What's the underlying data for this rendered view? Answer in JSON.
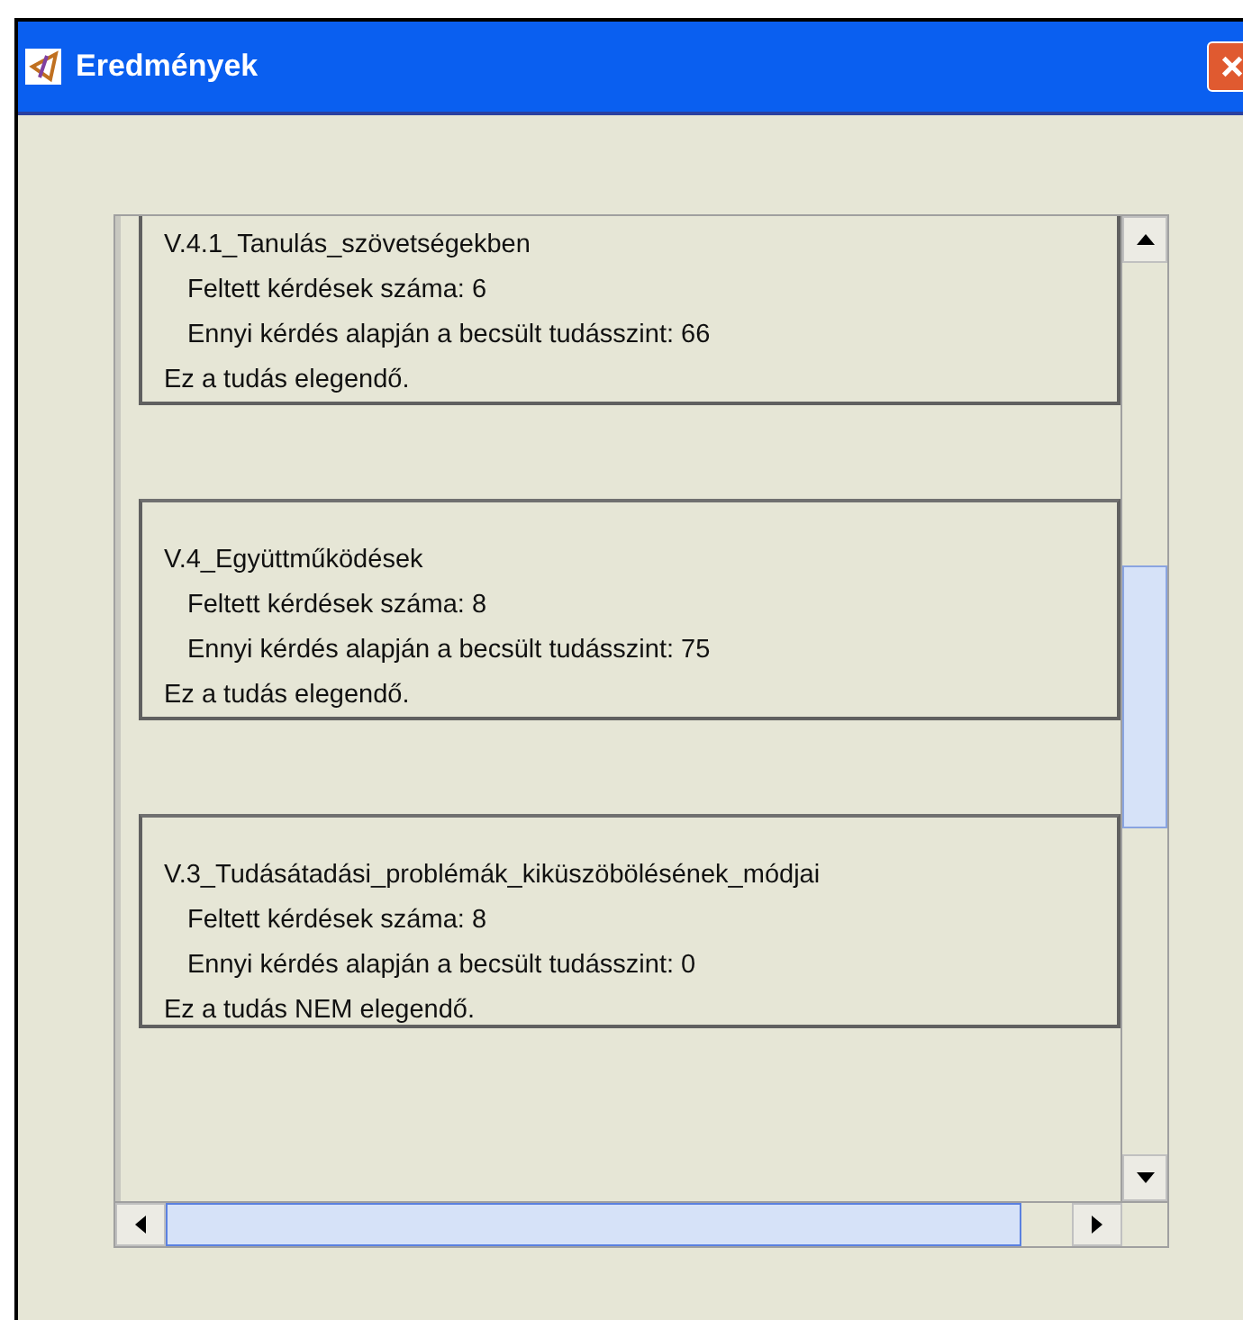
{
  "window": {
    "title": "Eredmények"
  },
  "results": [
    {
      "topic": "V.4.1_Tanulás_szövetségekben",
      "questions": "Feltett kérdések száma: 6",
      "estimate": "Ennyi kérdés alapján a becsült tudásszint: 66",
      "verdict": "Ez a tudás elegendő."
    },
    {
      "topic": "V.4_Együttműködések",
      "questions": "Feltett kérdések száma: 8",
      "estimate": "Ennyi kérdés alapján a becsült tudásszint: 75",
      "verdict": "Ez a tudás elegendő."
    },
    {
      "topic": "V.3_Tudásátadási_problémák_kiküszöbölésének_módjai",
      "questions": "Feltett kérdések száma: 8",
      "estimate": "Ennyi kérdés alapján a becsült tudásszint: 0",
      "verdict": "Ez a tudás NEM elegendő."
    }
  ]
}
